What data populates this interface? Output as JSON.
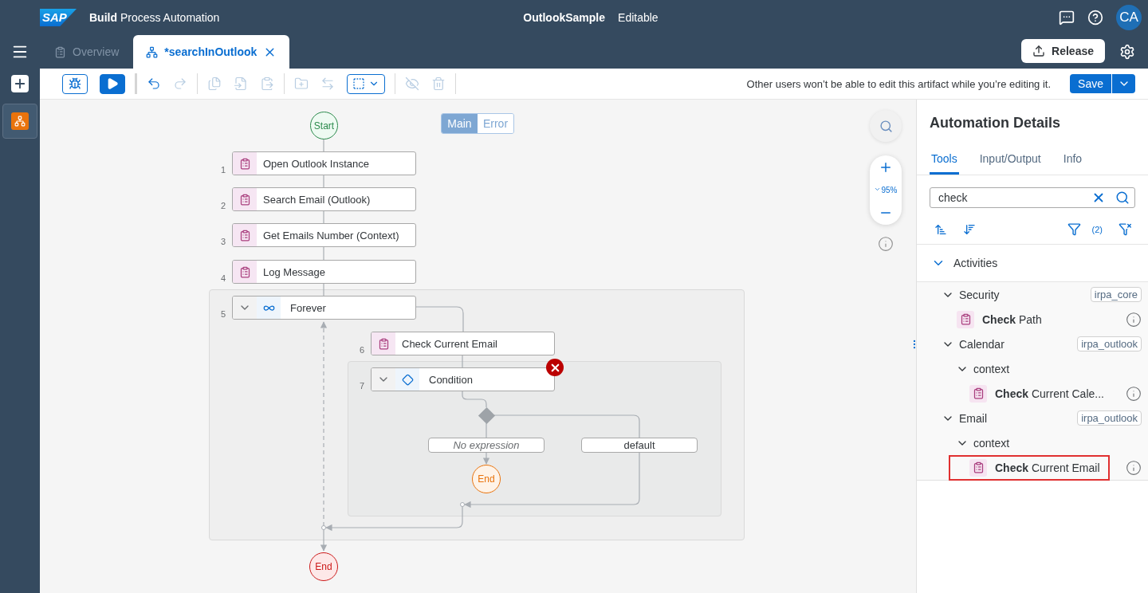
{
  "header": {
    "logo": "SAP",
    "product": "**Build** Process Automation",
    "title": "OutlookSample",
    "status": "Editable",
    "avatar": "CA"
  },
  "tabs": [
    {
      "label": "Overview",
      "selected": false,
      "closable": false
    },
    {
      "label": "*searchInOutlook",
      "selected": true,
      "closable": true
    }
  ],
  "release_button": "Release",
  "toolbar": {
    "groups": [
      [
        {
          "kind": "debug",
          "disabled": false
        },
        {
          "kind": "run",
          "disabled": false
        }
      ],
      [
        {
          "kind": "undo",
          "disabled": false
        },
        {
          "kind": "redo",
          "disabled": true
        }
      ],
      [
        {
          "kind": "copy",
          "disabled": true
        },
        {
          "kind": "duplicate",
          "disabled": true
        },
        {
          "kind": "paste",
          "disabled": true
        }
      ],
      [
        {
          "kind": "add_group",
          "disabled": true
        },
        {
          "kind": "swap",
          "disabled": true
        },
        {
          "kind": "select",
          "disabled": false
        }
      ],
      [
        {
          "kind": "hide",
          "disabled": true
        },
        {
          "kind": "delete",
          "disabled": true
        }
      ]
    ],
    "notice": "Other users won’t be able to edit this artifact while you’re editing it.",
    "save_button": "Save"
  },
  "canvas": {
    "flow_tabs": [
      {
        "label": "Main",
        "selected": true
      },
      {
        "label": "Error",
        "selected": false
      }
    ],
    "start": "Start",
    "steps": [
      {
        "number": "1",
        "label": "Open Outlook Instance",
        "kind": "activity",
        "error": false
      },
      {
        "number": "2",
        "label": "Search Email (Outlook)",
        "kind": "activity",
        "error": false
      },
      {
        "number": "3",
        "label": "Get Emails Number (Context)",
        "kind": "activity",
        "error": false
      },
      {
        "number": "4",
        "label": "Log Message",
        "kind": "activity",
        "error": false
      },
      {
        "number": "5",
        "label": "Forever",
        "kind": "loop",
        "expanded": true,
        "error": false
      },
      {
        "number": "6",
        "label": "Check Current Email",
        "kind": "activity",
        "error": false
      },
      {
        "number": "7",
        "label": "Condition",
        "kind": "condition",
        "expanded": true,
        "error": true
      }
    ],
    "branches": [
      {
        "label": "No expression",
        "kind": "empty"
      },
      {
        "label": "default",
        "kind": "default"
      }
    ],
    "ends": [
      {
        "label": "End",
        "kind": "branch"
      },
      {
        "label": "End",
        "kind": "final"
      }
    ],
    "zoom": "95%"
  },
  "panel": {
    "title": "Automation Details",
    "tabs": [
      {
        "label": "Tools",
        "selected": true
      },
      {
        "label": "Input/Output",
        "selected": false
      },
      {
        "label": "Info",
        "selected": false
      }
    ],
    "search": {
      "value": "check"
    },
    "filter_count": "(2)",
    "tree": {
      "label": "Activities",
      "expanded": true,
      "children": [
        {
          "kind": "folder",
          "label": "Security",
          "tag": "irpa_core",
          "expanded": true,
          "children": [
            {
              "kind": "activity",
              "label": "**Check** Path",
              "highlighted": false
            }
          ]
        },
        {
          "kind": "folder",
          "label": "Calendar",
          "tag": "irpa_outlook",
          "expanded": true,
          "children": [
            {
              "kind": "folder",
              "label": "context",
              "expanded": true,
              "children": [
                {
                  "kind": "activity",
                  "label": "**Check** Current Cale...",
                  "highlighted": false
                }
              ]
            }
          ]
        },
        {
          "kind": "folder",
          "label": "Email",
          "tag": "irpa_outlook",
          "expanded": true,
          "children": [
            {
              "kind": "folder",
              "label": "context",
              "expanded": true,
              "children": [
                {
                  "kind": "activity",
                  "label": "**Check** Current Email",
                  "highlighted": true
                }
              ]
            }
          ]
        }
      ]
    }
  }
}
